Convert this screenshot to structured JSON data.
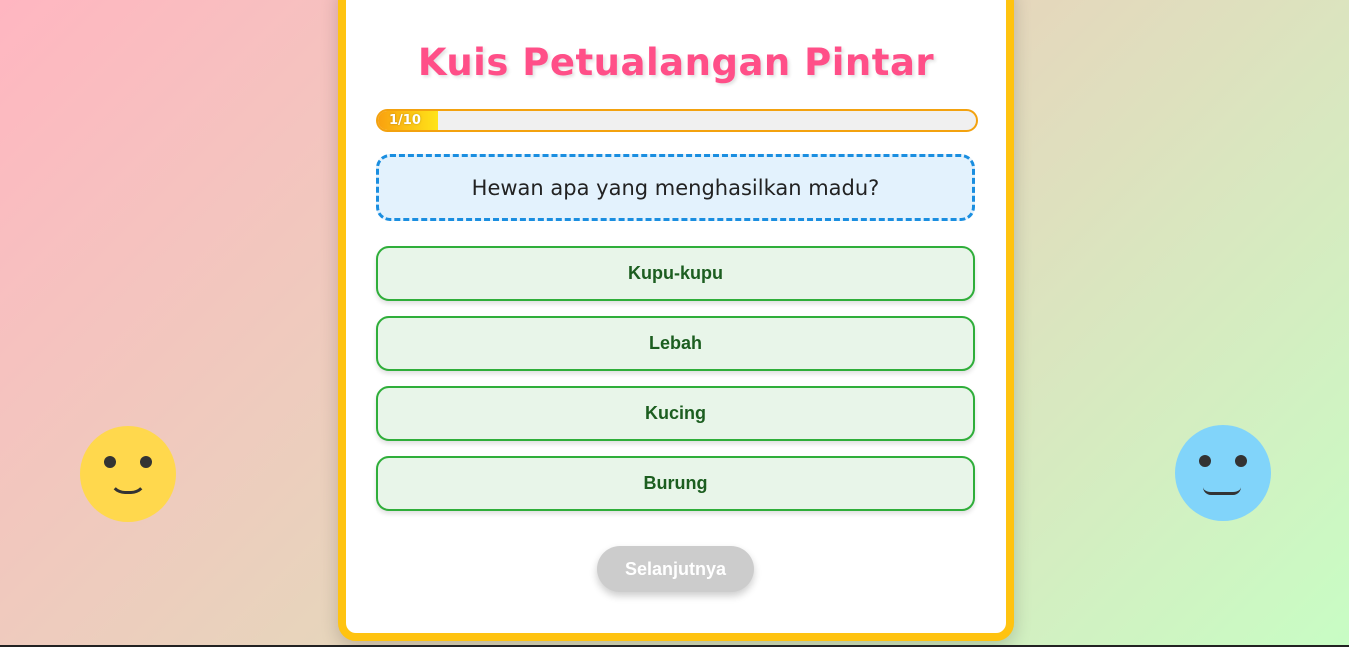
{
  "quiz": {
    "title": "Kuis Petualangan Pintar",
    "progress": {
      "text": "1/10",
      "current": 1,
      "total": 10
    },
    "question": "Hewan apa yang menghasilkan madu?",
    "options": [
      "Kupu-kupu",
      "Lebah",
      "Kucing",
      "Burung"
    ],
    "next_label": "Selanjutnya"
  },
  "decorations": {
    "left_smiley": "smiley-face-icon",
    "right_smiley": "neutral-face-icon"
  },
  "colors": {
    "title": "#ff4f88",
    "card_border": "#ffc310",
    "question_border": "#1a8ee0",
    "option_border": "#2fae3a",
    "option_text": "#1c5e20",
    "next_disabled": "#cccccc"
  }
}
